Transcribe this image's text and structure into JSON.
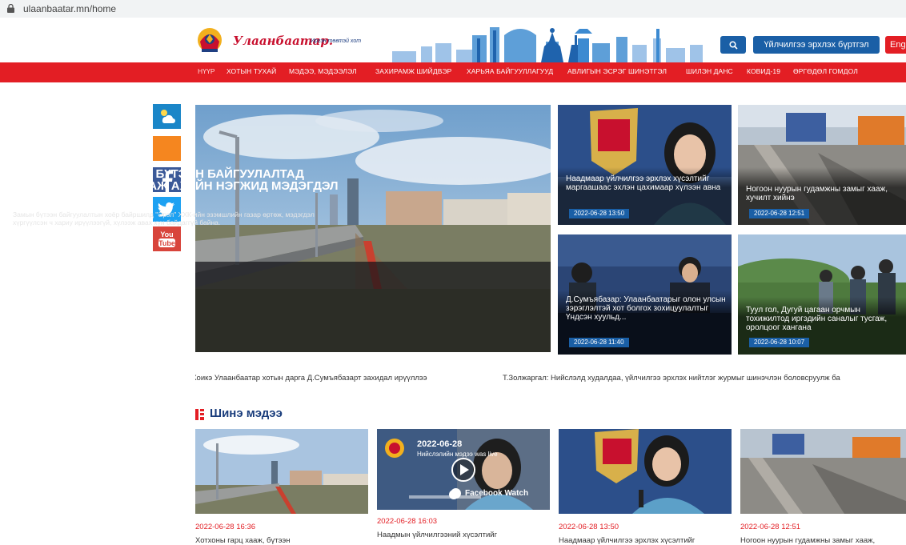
{
  "browser": {
    "url": "ulaanbaatar.mn/home"
  },
  "header": {
    "logo_title": "Улаанбаатар.",
    "logo_sub": "Иргэн төвтэй хот",
    "register_label": "Үйлчилгээ эрхлэх бүртгэл",
    "lang_label": "Eng"
  },
  "nav": [
    "НҮҮР",
    "ХОТЫН ТУХАЙ",
    "МЭДЭЭ, МЭДЭЭЛЭЛ",
    "ЗАХИРАМЖ ШИЙДВЭР",
    "ХАРЬЯА БАЙГУУЛЛАГУУД",
    "АВЛИГЫН ЭСРЭГ ШИНЭТГЭЛ",
    "ШИЛЭН ДАНС",
    "КОВИД-19",
    "ӨРГӨДӨЛ ГОМДОЛ"
  ],
  "hero": {
    "title": "ХОТХОНЫ ГАРЦ ХААЖ, БҮТЭЭН БАЙГУУЛАЛТАД ХҮНДРЭЛ УЧРУУЛСАН АЖ АХУЙН НЭГЖИД МЭДЭГДЭЛ ХҮРГҮҮЛЛЭЭ",
    "desc": "Замын бүтээн байгуулалтын хоёр байршилд \"Эрэл\" ХХК-ийн эзэмшлийн газар өртөж, мэдэгдэл хүргүүлсэн ч хариу ирүүлээгүй, хүлээж авах хүн байдаггүй байна."
  },
  "cards": [
    {
      "title": "Наадмаар үйлчилгээ эрхлэх хүсэлтийг маргаашаас эхлэн цахимаар хүлээн авна",
      "date": "2022-06-28 13:50"
    },
    {
      "title": "Ногоон нуурын гудамжны замыг хааж, хучилт хийнэ",
      "date": "2022-06-28 12:51"
    },
    {
      "title": "Д.Сумъябазар: Улаанбаатарыг олон улсын зэрэглэлтэй хот болгох зохицуулалтыг Үндсэн хуульд...",
      "date": "2022-06-28 11:40"
    },
    {
      "title": "Туул гол, Дугуй цагаан орчмын тохижилтод иргэдийн саналыг тусгаж, оролцоог хангана",
      "date": "2022-06-28 10:07"
    }
  ],
  "ticker": [
    "Коикэ Улаанбаатар хотын дарга Д.Сумъябазарт захидал ирүүллээ",
    "Т.Золжаргал: Нийслэлд худалдаа, үйлчилгээ эрхлэх нийтлэг журмыг шинэчлэн боловсруулж ба"
  ],
  "news_heading": "Шинэ мэдээ",
  "news": [
    {
      "date": "2022-06-28 16:36",
      "title": "Хотхоны гарц хааж, бүтээн"
    },
    {
      "date": "2022-06-28 16:03",
      "title": "Наадмын үйлчилгээний хүсэлтийг",
      "video_date": "2022-06-28",
      "video_sub": "Нийслэлийн мэдээ was live",
      "video_badge": "Facebook Watch"
    },
    {
      "date": "2022-06-28 13:50",
      "title": "Наадмаар үйлчилгээ эрхлэх хүсэлтийг"
    },
    {
      "date": "2022-06-28 12:51",
      "title": "Ногоон нуурын гудамжны замыг хааж,"
    }
  ],
  "colors": {
    "brand_red": "#e31e24",
    "brand_blue": "#1a5fa6",
    "heading_blue": "#1a3d7c"
  }
}
